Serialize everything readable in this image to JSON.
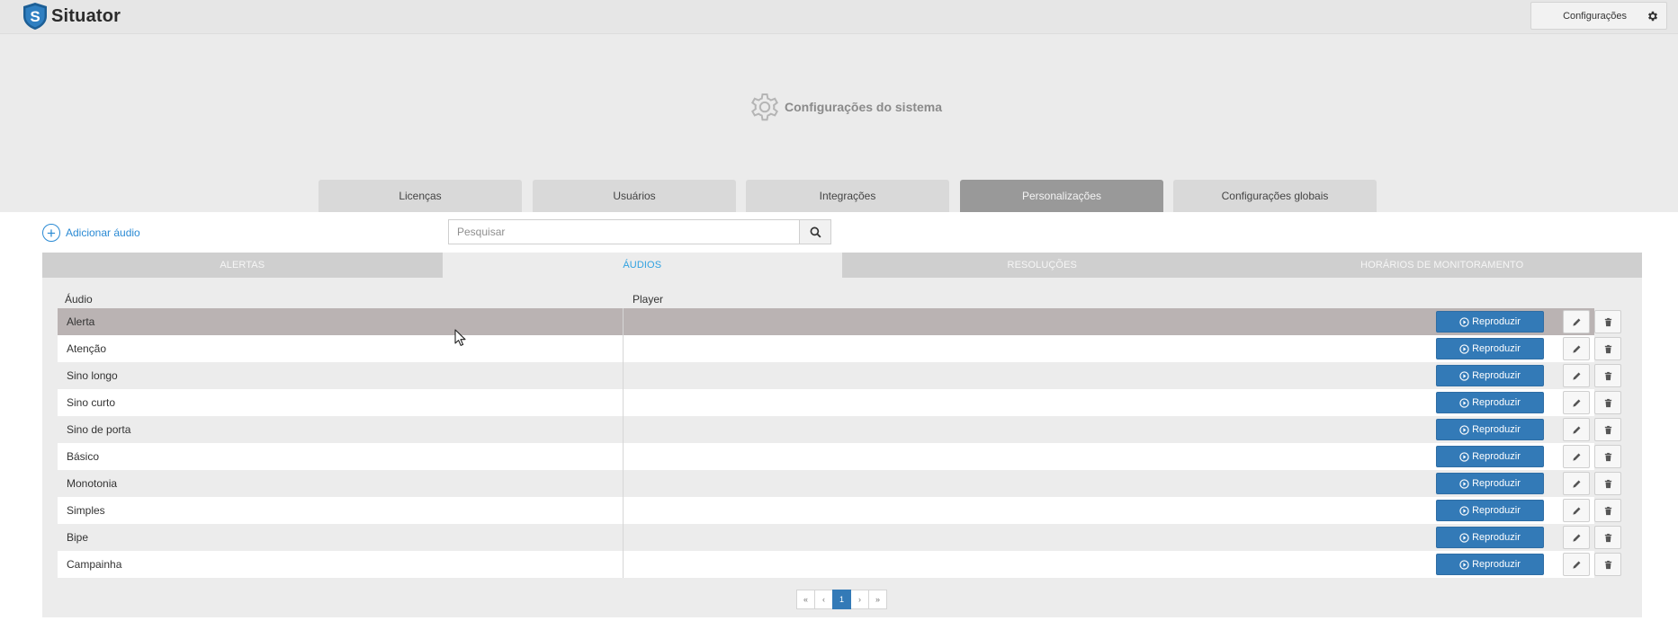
{
  "header": {
    "brand": "Situator",
    "brand_letter": "S",
    "config_label": "Configurações"
  },
  "page": {
    "title": "Configurações do sistema"
  },
  "main_tabs": [
    {
      "label": "Licenças",
      "active": false
    },
    {
      "label": "Usuários",
      "active": false
    },
    {
      "label": "Integrações",
      "active": false
    },
    {
      "label": "Personalizações",
      "active": true
    },
    {
      "label": "Configurações globais",
      "active": false
    }
  ],
  "toolbar": {
    "add_label": "Adicionar áudio",
    "search_placeholder": "Pesquisar",
    "search_value": ""
  },
  "sub_tabs": [
    {
      "label": "ALERTAS",
      "active": false
    },
    {
      "label": "ÁUDIOS",
      "active": true
    },
    {
      "label": "RESOLUÇÕES",
      "active": false
    },
    {
      "label": "HORÁRIOS DE MONITORAMENTO",
      "active": false
    }
  ],
  "table": {
    "columns": [
      "Áudio",
      "Player"
    ],
    "play_label": "Reproduzir",
    "rows": [
      {
        "name": "Alerta"
      },
      {
        "name": "Atenção"
      },
      {
        "name": "Sino longo"
      },
      {
        "name": "Sino curto"
      },
      {
        "name": "Sino de porta"
      },
      {
        "name": "Básico"
      },
      {
        "name": "Monotonia"
      },
      {
        "name": "Simples"
      },
      {
        "name": "Bipe"
      },
      {
        "name": "Campainha"
      }
    ],
    "hover_row": 0
  },
  "pagination": {
    "first": "«",
    "prev": "‹",
    "current": "1",
    "next": "›",
    "last": "»"
  },
  "colors": {
    "accent": "#2a8ad4",
    "primary_button": "#337ab7",
    "active_tab": "#999999",
    "hover_row": "#bab3b3"
  },
  "icons": [
    "shield-logo-icon",
    "gear-icon",
    "plus-circle-icon",
    "search-icon",
    "play-circle-icon",
    "pencil-icon",
    "trash-icon",
    "mouse-cursor-icon"
  ]
}
